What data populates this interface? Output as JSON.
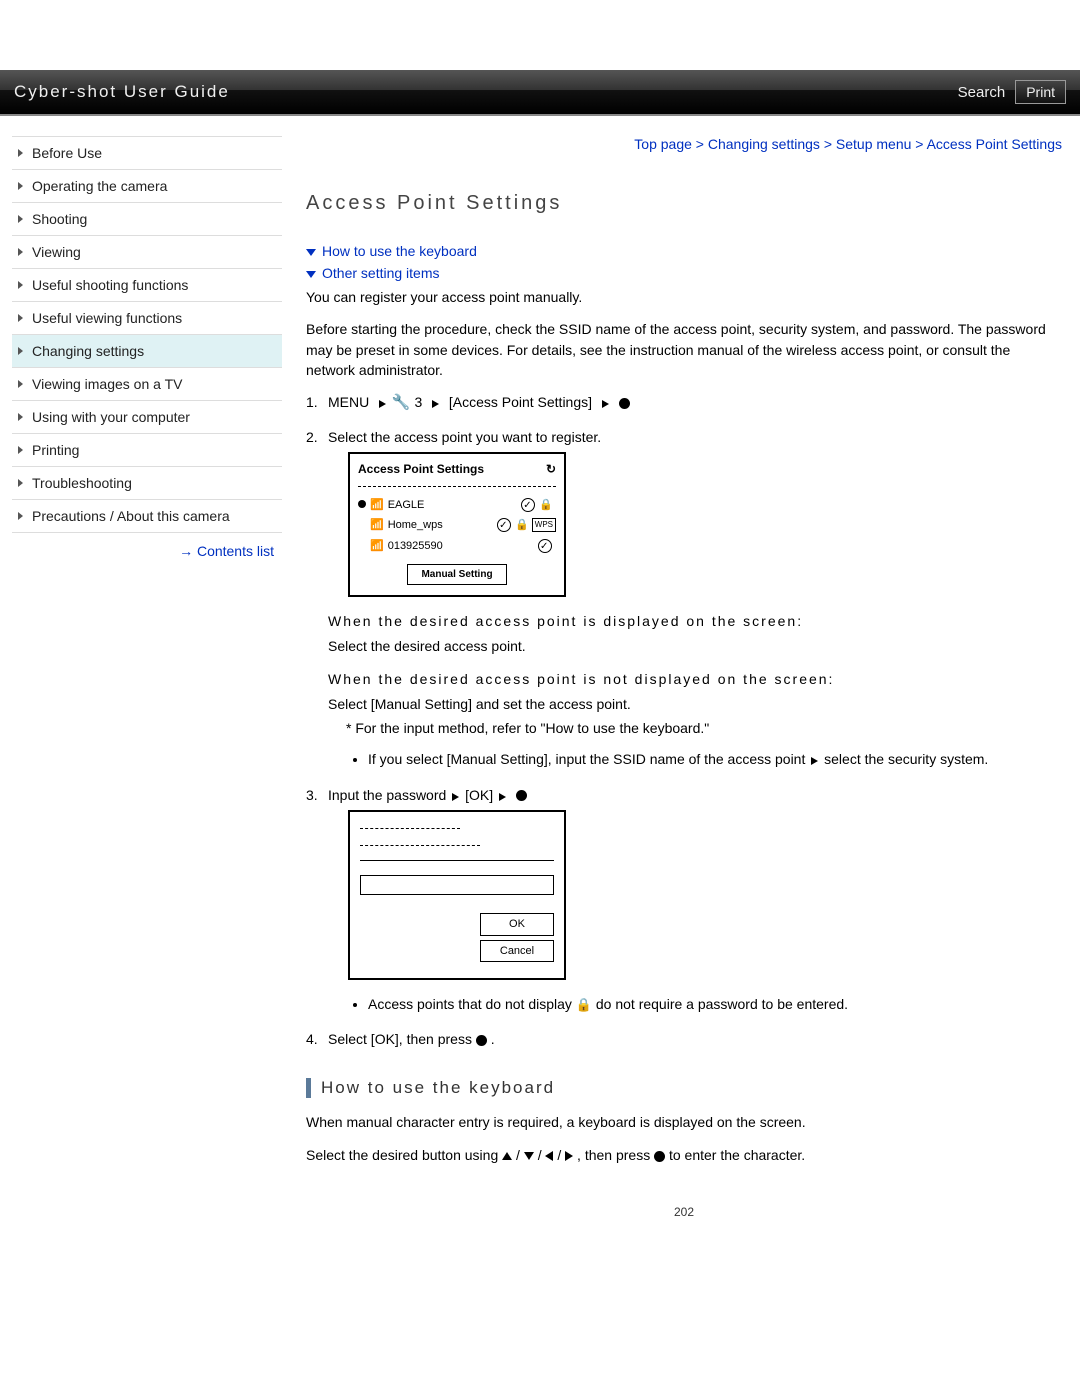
{
  "header": {
    "title": "Cyber-shot User Guide",
    "search_label": "Search",
    "print_label": "Print"
  },
  "sidebar": {
    "items": [
      "Before Use",
      "Operating the camera",
      "Shooting",
      "Viewing",
      "Useful shooting functions",
      "Useful viewing functions",
      "Changing settings",
      "Viewing images on a TV",
      "Using with your computer",
      "Printing",
      "Troubleshooting",
      "Precautions / About this camera"
    ],
    "active_index": 6,
    "contents_list": "Contents list"
  },
  "breadcrumb": [
    "Top page",
    "Changing settings",
    "Setup menu",
    "Access Point Settings"
  ],
  "content": {
    "h1": "Access Point Settings",
    "anchors": [
      "How to use the keyboard",
      "Other setting items"
    ],
    "intro1": "You can register your access point manually.",
    "intro2": "Before starting the procedure, check the SSID name of the access point, security system, and password. The password may be preset in some devices. For details, see the instruction manual of the wireless access point, or consult the network administrator.",
    "step1_menu": "MENU",
    "step1_num": "3",
    "step1_target": "[Access Point Settings]",
    "step2": "Select the access point you want to register.",
    "shot1": {
      "title": "Access Point Settings",
      "rows": [
        {
          "selected": true,
          "name": "EAGLE",
          "check": true,
          "lock": true,
          "wps": false
        },
        {
          "selected": false,
          "name": "Home_wps",
          "check": true,
          "lock": true,
          "wps": true
        },
        {
          "selected": false,
          "name": "013925590",
          "check": true,
          "lock": false,
          "wps": false
        }
      ],
      "manual": "Manual Setting"
    },
    "when_displayed_h": "When the desired access point is displayed on the screen:",
    "when_displayed_t": "Select the desired access point.",
    "when_not_h": "When the desired access point is not displayed on the screen:",
    "when_not_t": "Select [Manual Setting] and set the access point.",
    "star_note": "* For the input method, refer to \"How to use the keyboard.\"",
    "manual_bullet": "If you select [Manual Setting], input the SSID name of the access point ",
    "manual_bullet_tail": " select the security system.",
    "step3_a": "Input the password ",
    "step3_b": " [OK] ",
    "shot2": {
      "ok": "OK",
      "cancel": "Cancel"
    },
    "lock_note_a": "Access points that do not display ",
    "lock_note_b": " do not require a password to be entered.",
    "step4": "Select [OK], then press ",
    "h2": "How to use the keyboard",
    "kb1": "When manual character entry is required, a keyboard is displayed on the screen.",
    "kb2_a": "Select the desired button using ",
    "kb2_b": " , then press ",
    "kb2_c": " to enter the character."
  },
  "page_number": "202"
}
